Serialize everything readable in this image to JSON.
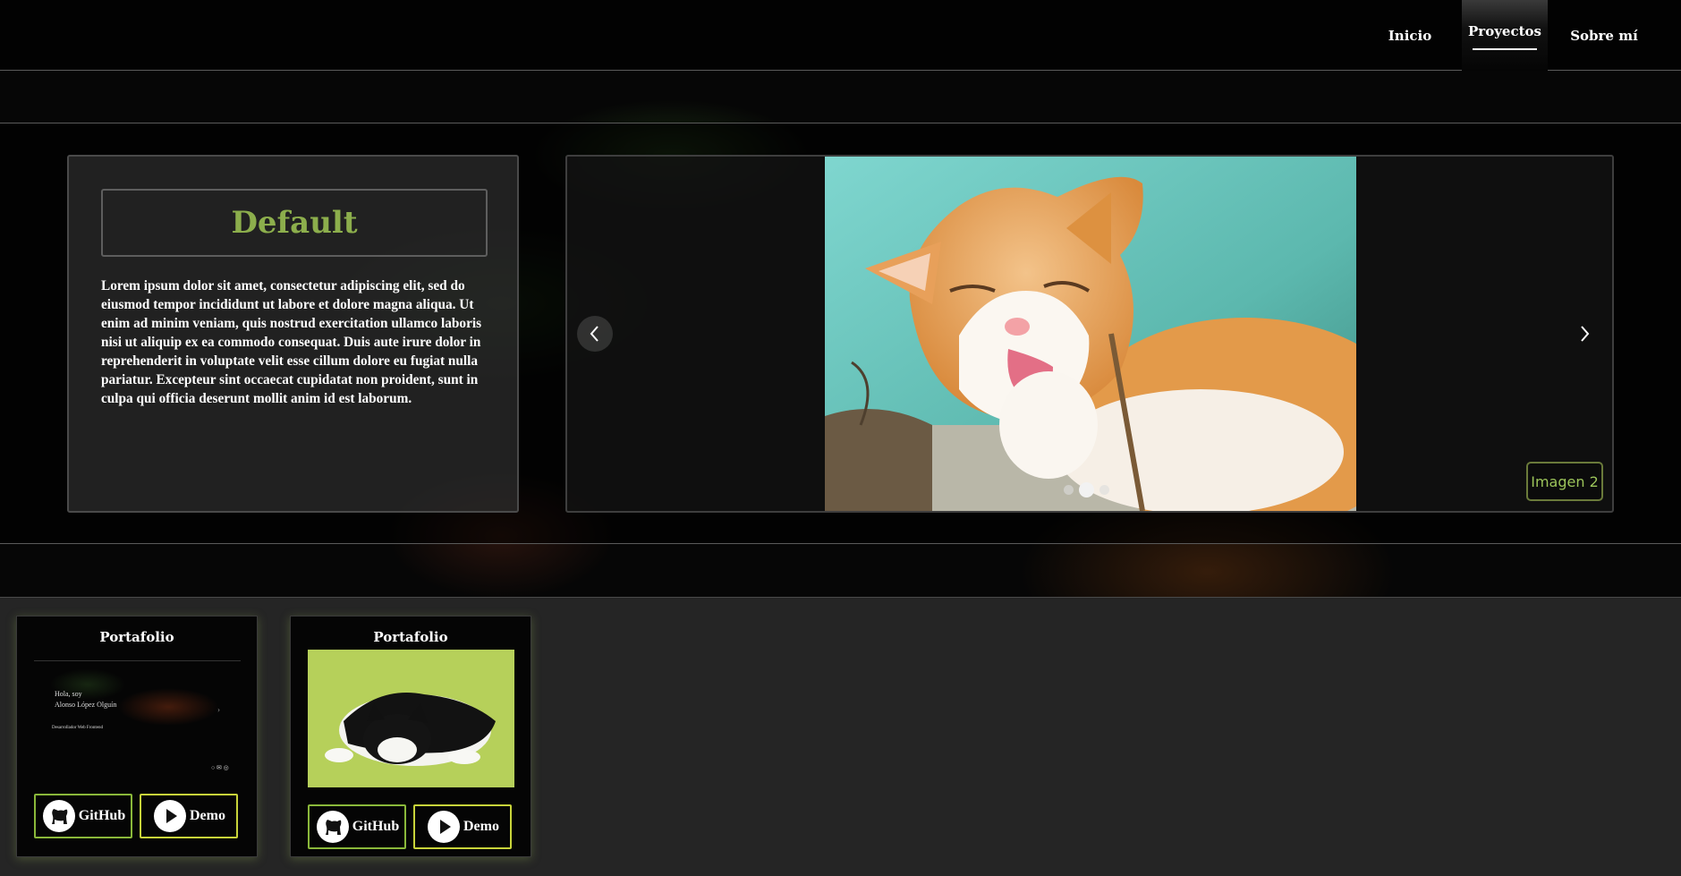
{
  "nav": {
    "items": [
      {
        "label": "Inicio"
      },
      {
        "label": "Proyectos",
        "active": true
      },
      {
        "label": "Sobre mí"
      }
    ]
  },
  "feature": {
    "title": "Default",
    "description": "Lorem ipsum dolor sit amet, consectetur adipiscing elit, sed do eiusmod tempor incididunt ut labore et dolore magna aliqua. Ut enim ad minim veniam, quis nostrud exercitation ullamco laboris nisi ut aliquip ex ea commodo consequat. Duis aute irure dolor in reprehenderit in voluptate velit esse cillum dolore eu fugiat nulla pariatur. Excepteur sint occaecat cupidatat non proident, sunt in culpa qui officia deserunt mollit anim id est laborum."
  },
  "carousel": {
    "image_label": "Imagen 2",
    "slide_count": 3,
    "active_slide": 2,
    "prev_icon": "chevron-left-icon",
    "next_icon": "chevron-right-icon"
  },
  "projects": [
    {
      "title": "Portafolio",
      "thumb": "site-preview",
      "preview": {
        "greeting": "Hola, soy",
        "name": "Alonso López Olguín",
        "subtitle": "Desarrollador Web Frontend"
      },
      "github_label": "GitHub",
      "demo_label": "Demo"
    },
    {
      "title": "Portafolio",
      "thumb": "cat-photo",
      "github_label": "GitHub",
      "demo_label": "Demo"
    }
  ],
  "colors": {
    "accent_green": "#8cae4c",
    "button_yellow": "#c8d43a",
    "button_green": "#8ab83a"
  }
}
